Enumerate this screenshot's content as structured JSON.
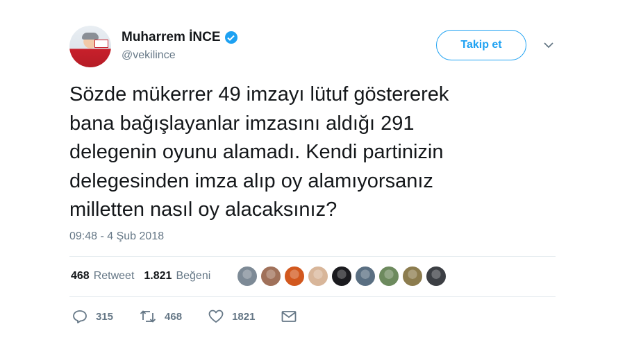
{
  "author": {
    "name": "Muharrem İNCE",
    "handle": "@vekilince",
    "verified": true
  },
  "header": {
    "follow_label": "Takip et"
  },
  "tweet": {
    "text": "Sözde mükerrer 49 imzayı lütuf göstererek\nbana bağışlayanlar imzasını aldığı 291\ndelegenin oyunu alamadı. Kendi partinizin\ndelegesinden imza alıp oy alamıyorsanız\nmilletten nasıl oy alacaksınız?",
    "timestamp": "09:48 - 4 Şub 2018"
  },
  "stats": {
    "retweet_count": "468",
    "retweet_label": "Retweet",
    "like_count": "1.821",
    "like_label": "Beğeni"
  },
  "likers": [
    {
      "color": "#7d8a96"
    },
    {
      "color": "#a0715a"
    },
    {
      "color": "#d2581e"
    },
    {
      "color": "#d8b69a"
    },
    {
      "color": "#1b1b1f"
    },
    {
      "color": "#5a6f82"
    },
    {
      "color": "#6d8a5e"
    },
    {
      "color": "#8c7c4e"
    },
    {
      "color": "#3c3f44"
    }
  ],
  "actions": {
    "reply_count": "315",
    "retweet_count": "468",
    "like_count": "1821"
  },
  "colors": {
    "accent": "#1da1f2",
    "muted": "#657786",
    "divider": "#e6ecf0"
  }
}
